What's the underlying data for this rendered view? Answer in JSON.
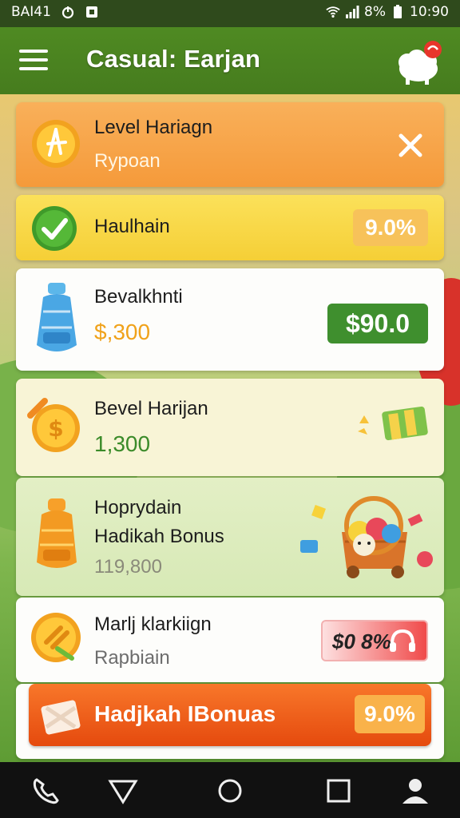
{
  "status": {
    "time_left": "BAI41",
    "battery": "8%",
    "clock": "10:90"
  },
  "app": {
    "title": "Casual: Earjan"
  },
  "rows": [
    {
      "title": "Level Hariagn",
      "subtitle": "Rypoan",
      "action": "close"
    },
    {
      "title": "Haulhain",
      "badge": "9.0%"
    },
    {
      "title": "Bevalkhnti",
      "subtitle": "$,300",
      "badge": "$90.0"
    },
    {
      "title": "Bevel Harijan",
      "subtitle": "1,300"
    },
    {
      "title_line1": "Hoprydain",
      "title_line2": "Hadikah Bonus",
      "subtitle": "119,800"
    },
    {
      "title": "Marlj klarkiign",
      "subtitle": "Rapbiain",
      "badge": "$0 8%"
    },
    {
      "title": "Hadjkah IBonuas",
      "badge": "9.0%"
    }
  ],
  "icons": {
    "star_coin": "star-coin-icon",
    "check": "check-icon",
    "bottle_blue": "blue-bottle-icon",
    "coin": "coin-icon",
    "bottle_orange": "orange-bottle-icon",
    "chest": "treasure-cart-icon",
    "gift": "gift-box-icon"
  },
  "colors": {
    "header": "#4f8a22",
    "row_orange": "#f9a646",
    "row_yellow": "#f9d94a",
    "badge_green": "#3f8f2e",
    "bonus_orange": "#ef5a12"
  }
}
